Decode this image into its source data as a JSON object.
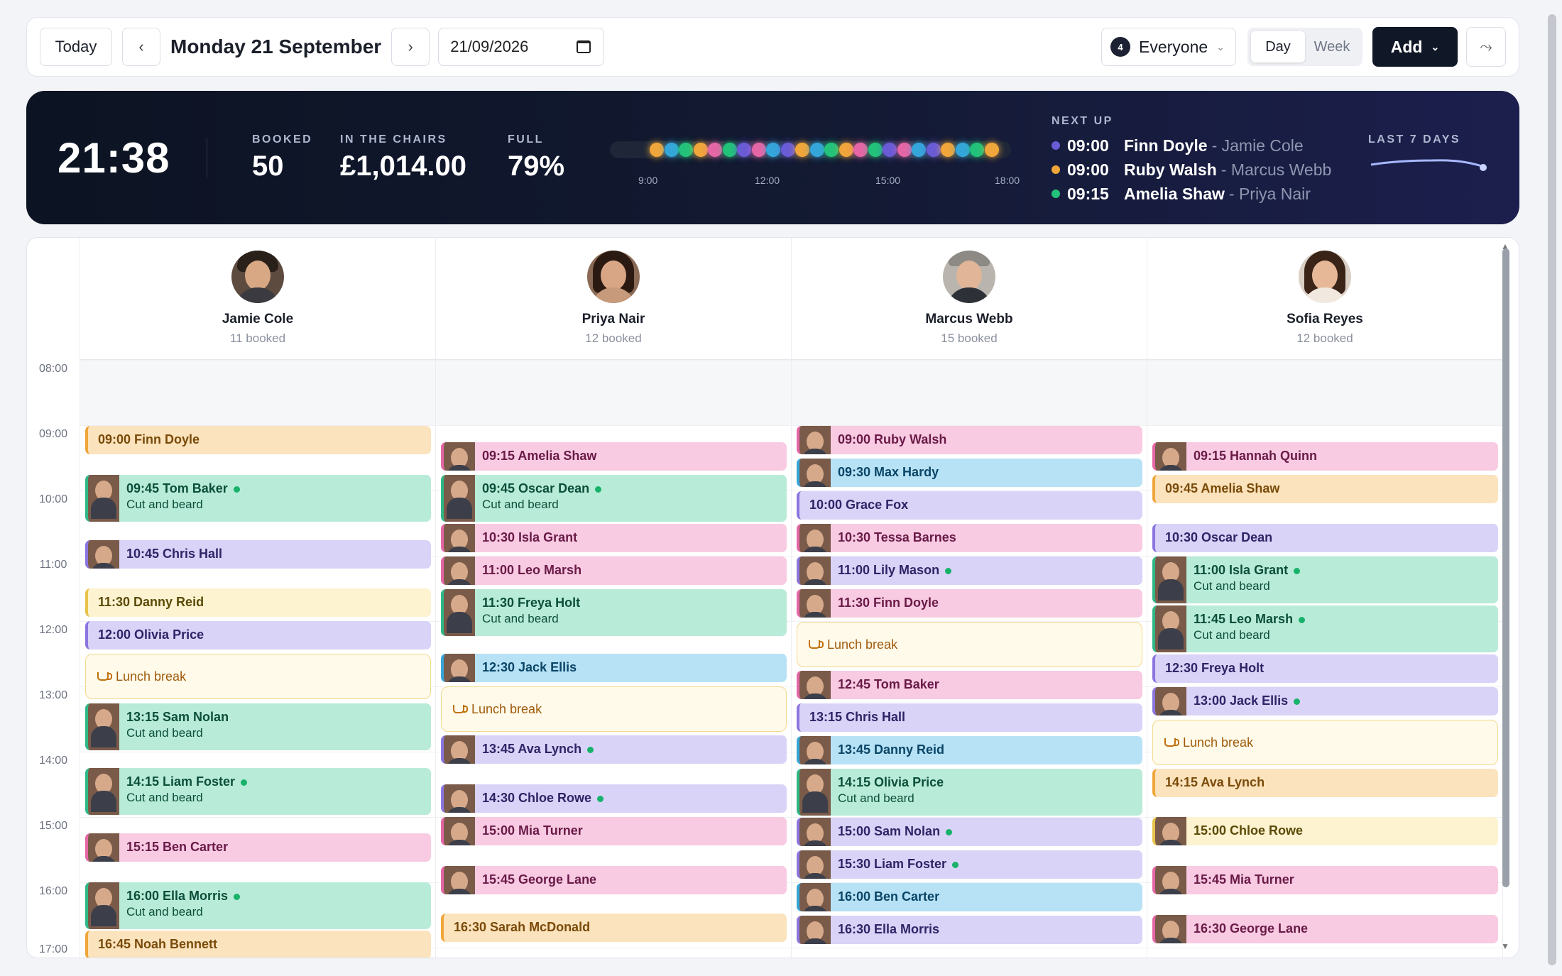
{
  "toolbar": {
    "today_label": "Today",
    "date_title": "Monday 21 September",
    "date_value": "21/09/2026",
    "staff_count": "4",
    "staff_filter": "Everyone",
    "view_day": "Day",
    "view_week": "Week",
    "add_label": "Add"
  },
  "banner": {
    "clock": "21:38",
    "booked_label": "BOOKED",
    "booked_value": "50",
    "chairs_label": "IN THE CHAIRS",
    "chairs_value": "£1,014.00",
    "full_label": "FULL",
    "full_value": "79%",
    "ticks": [
      "9:00",
      "12:00",
      "15:00",
      "18:00"
    ],
    "next_up_label": "NEXT UP",
    "next_up": [
      {
        "time": "09:00",
        "client": "Finn Doyle",
        "staff": "- Jamie Cole",
        "color": "#6a5bd6"
      },
      {
        "time": "09:00",
        "client": "Ruby Walsh",
        "staff": "- Marcus Webb",
        "color": "#f0a63a"
      },
      {
        "time": "09:15",
        "client": "Amelia Shaw",
        "staff": "- Priya Nair",
        "color": "#22c27a"
      }
    ],
    "last7_label": "LAST 7 DAYS"
  },
  "staff": [
    {
      "name": "Jamie Cole",
      "booked": "11 booked"
    },
    {
      "name": "Priya Nair",
      "booked": "12 booked"
    },
    {
      "name": "Marcus Webb",
      "booked": "15 booked"
    },
    {
      "name": "Sofia Reyes",
      "booked": "12 booked"
    }
  ],
  "hours": [
    "08:00",
    "09:00",
    "10:00",
    "11:00",
    "12:00",
    "13:00",
    "14:00",
    "15:00",
    "16:00",
    "17:00"
  ],
  "lunch_label": "Lunch break",
  "service_label": "Cut and beard",
  "appointments": {
    "jamie": [
      {
        "label": "09:00 Finn Doyle"
      },
      {
        "label": "09:45 Tom Baker"
      },
      {
        "label": "10:45 Chris Hall"
      },
      {
        "label": "11:30 Danny Reid"
      },
      {
        "label": "12:00 Olivia Price"
      },
      {
        "label": "13:15 Sam Nolan"
      },
      {
        "label": "14:15 Liam Foster"
      },
      {
        "label": "15:15 Ben Carter"
      },
      {
        "label": "16:00 Ella Morris"
      },
      {
        "label": "16:45 Noah Bennett"
      }
    ],
    "priya": [
      {
        "label": "09:15 Amelia Shaw"
      },
      {
        "label": "09:45 Oscar Dean"
      },
      {
        "label": "10:30 Isla Grant"
      },
      {
        "label": "11:00 Leo Marsh"
      },
      {
        "label": "11:30 Freya Holt"
      },
      {
        "label": "12:30 Jack Ellis"
      },
      {
        "label": "13:45 Ava Lynch"
      },
      {
        "label": "14:30 Chloe Rowe"
      },
      {
        "label": "15:00 Mia Turner"
      },
      {
        "label": "15:45 George Lane"
      },
      {
        "label": "16:30 Sarah McDonald"
      }
    ],
    "marcus": [
      {
        "label": "09:00 Ruby Walsh"
      },
      {
        "label": "09:30 Max Hardy"
      },
      {
        "label": "10:00 Grace Fox"
      },
      {
        "label": "10:30 Tessa Barnes"
      },
      {
        "label": "11:00 Lily Mason"
      },
      {
        "label": "11:30 Finn Doyle"
      },
      {
        "label": "12:45 Tom Baker"
      },
      {
        "label": "13:15 Chris Hall"
      },
      {
        "label": "13:45 Danny Reid"
      },
      {
        "label": "14:15 Olivia Price"
      },
      {
        "label": "15:00 Sam Nolan"
      },
      {
        "label": "15:30 Liam Foster"
      },
      {
        "label": "16:00 Ben Carter"
      },
      {
        "label": "16:30 Ella Morris"
      }
    ],
    "sofia": [
      {
        "label": "09:15 Hannah Quinn"
      },
      {
        "label": "09:45 Amelia Shaw"
      },
      {
        "label": "10:30 Oscar Dean"
      },
      {
        "label": "11:00 Isla Grant"
      },
      {
        "label": "11:45 Leo Marsh"
      },
      {
        "label": "12:30 Freya Holt"
      },
      {
        "label": "13:00 Jack Ellis"
      },
      {
        "label": "14:15 Ava Lynch"
      },
      {
        "label": "15:00 Chloe Rowe"
      },
      {
        "label": "15:45 Mia Turner"
      },
      {
        "label": "16:30 George Lane"
      }
    ]
  }
}
